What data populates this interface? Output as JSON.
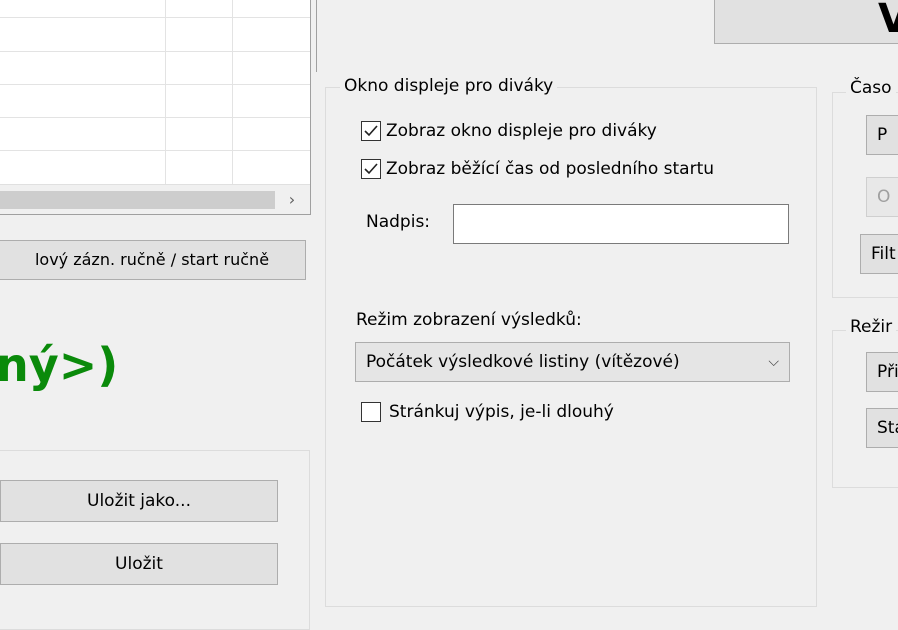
{
  "left": {
    "manual_button": "lový zázn. ručně / start ručně",
    "status_text": "ný>)",
    "save_as_button": "Uložit jako...",
    "save_button": "Uložit"
  },
  "viewer_display": {
    "legend": "Okno displeje pro diváky",
    "show_window": {
      "label": "Zobraz okno displeje pro diváky",
      "checked": true
    },
    "show_running_time": {
      "label": "Zobraz běžící čas od posledního startu",
      "checked": true
    },
    "title_label": "Nadpis:",
    "title_value": "",
    "results_mode_label": "Režim zobrazení výsledků:",
    "results_mode_value": "Počátek výsledkové listiny (vítězové)",
    "paginate": {
      "label": "Stránkuj výpis, je-li dlouhý",
      "checked": false
    }
  },
  "right": {
    "time_group_legend": "Časo",
    "time_buttons": [
      "P",
      "O",
      "Filt"
    ],
    "mode_group_legend": "Režir",
    "mode_buttons": [
      "Při",
      "Sta"
    ]
  },
  "top_button_glyph": "V",
  "scroll_right_arrow": "›"
}
